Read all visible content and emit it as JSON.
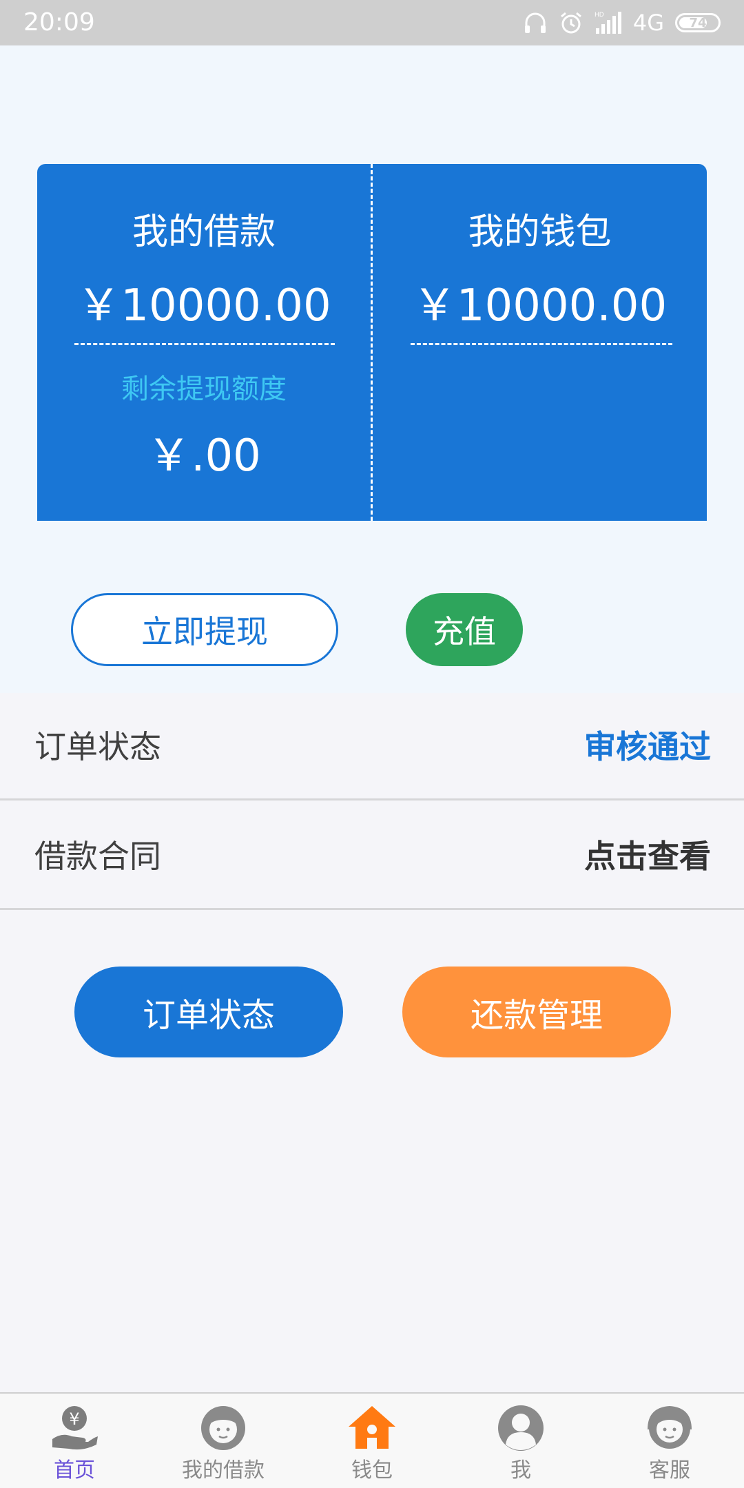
{
  "status_bar": {
    "time": "20:09",
    "network": "4G",
    "battery": "74",
    "battery_level": 0.74,
    "icons": [
      "headphones-icon",
      "alarm-icon",
      "signal-icon",
      "battery-icon"
    ]
  },
  "card": {
    "loan_title": "我的借款",
    "loan_amount": "￥10000.00",
    "remaining_label": "剩余提现额度",
    "remaining_amount": "￥.00",
    "wallet_title": "我的钱包",
    "wallet_amount": "￥10000.00"
  },
  "actions": {
    "withdraw_label": "立即提现",
    "recharge_label": "充值"
  },
  "rows": {
    "order_status_label": "订单状态",
    "order_status_value": "审核通过",
    "contract_label": "借款合同",
    "contract_value": "点击查看"
  },
  "big_buttons": {
    "order_label": "订单状态",
    "repay_label": "还款管理"
  },
  "tabbar": {
    "items": [
      {
        "label": "首页",
        "icon": "yen-hand-icon",
        "active": true
      },
      {
        "label": "我的借款",
        "icon": "person-icon"
      },
      {
        "label": "钱包",
        "icon": "house-icon"
      },
      {
        "label": "我",
        "icon": "user-icon"
      },
      {
        "label": "客服",
        "icon": "headset-person-icon"
      }
    ]
  },
  "colors": {
    "primary_blue": "#1976d6",
    "green": "#2ea55c",
    "orange": "#ff923c",
    "cyan_text": "#3ec8f3",
    "home_active": "#6a52d8"
  }
}
